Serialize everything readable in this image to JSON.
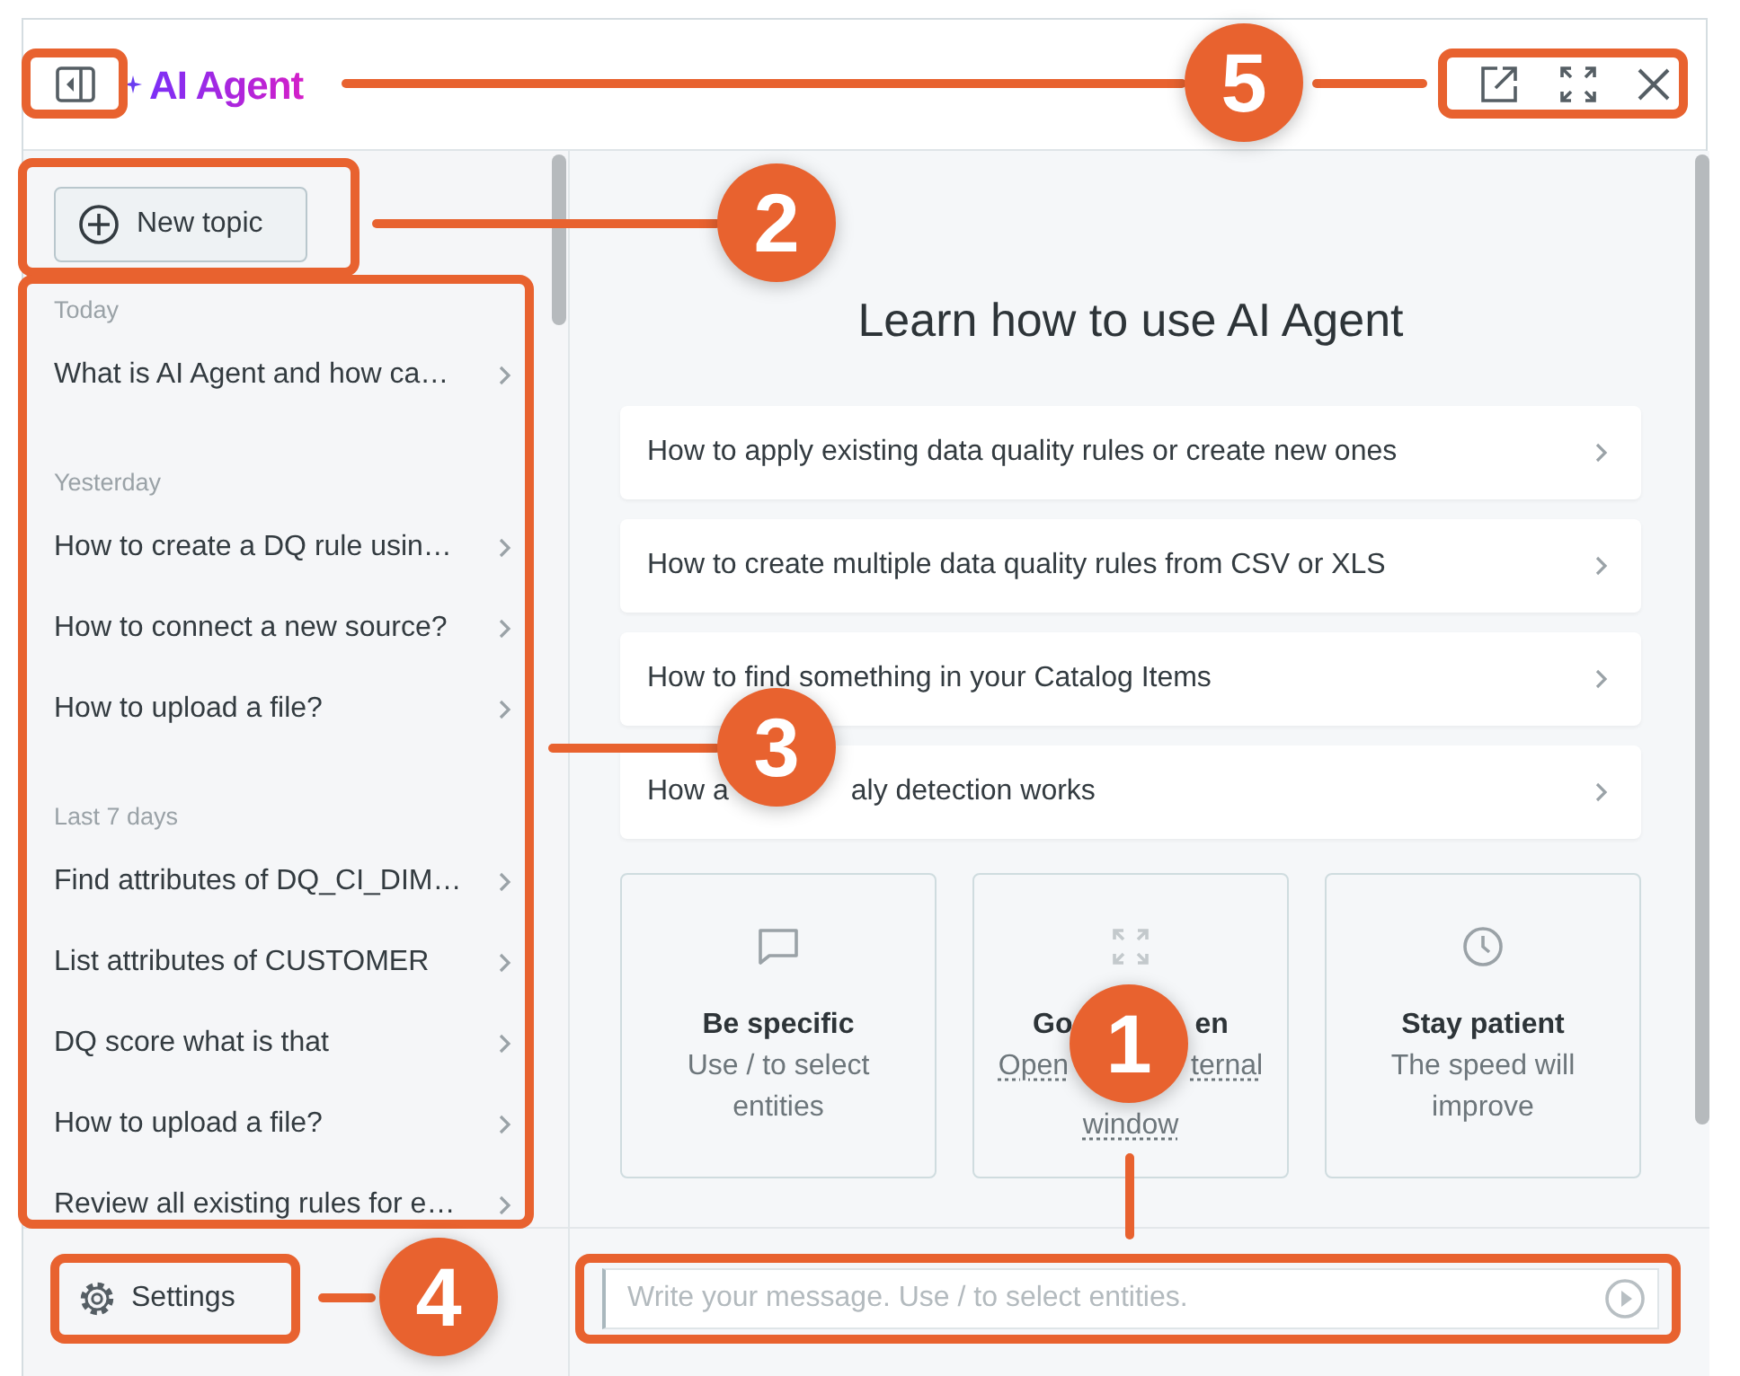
{
  "header": {
    "title": "AI Agent"
  },
  "sidebar": {
    "new_topic_button": "New topic",
    "groups": [
      {
        "label": "Today",
        "items": [
          "What is AI Agent and how ca…"
        ]
      },
      {
        "label": "Yesterday",
        "items": [
          "How to create a DQ rule usin…",
          "How to connect a new source?",
          "How to upload a file?"
        ]
      },
      {
        "label": "Last 7 days",
        "items": [
          "Find attributes of DQ_CI_DIM…",
          "List attributes of CUSTOMER",
          "DQ score what is that",
          "How to upload a file?",
          "Review all existing rules for e…"
        ]
      }
    ],
    "settings_button": "Settings"
  },
  "main": {
    "title": "Learn how to use AI Agent",
    "guides": [
      {
        "parts": [
          "How to apply existing data quality rules or create new ones"
        ]
      },
      {
        "parts": [
          "How to create multiple data quality rules from CSV or XLS"
        ]
      },
      {
        "parts": [
          "How to find something in your Catalog Items"
        ]
      },
      {
        "parts": [
          "How a",
          "aly detection works"
        ]
      }
    ],
    "tips": [
      {
        "kind": "specific",
        "title_parts": [
          "Be specific"
        ],
        "text_parts": [
          "Use / to select entities"
        ]
      },
      {
        "kind": "fullscreen",
        "title_parts": [
          "Go",
          "en"
        ],
        "link_parts": [
          "Open",
          "ternal"
        ],
        "link_tail": "window"
      },
      {
        "kind": "patient",
        "title_parts": [
          "Stay patient"
        ],
        "text_parts": [
          "The speed will improve"
        ]
      }
    ]
  },
  "composer": {
    "placeholder": "Write your message. Use / to select entities."
  },
  "callouts": [
    {
      "number": "1"
    },
    {
      "number": "2"
    },
    {
      "number": "3"
    },
    {
      "number": "4"
    },
    {
      "number": "5"
    }
  ]
}
